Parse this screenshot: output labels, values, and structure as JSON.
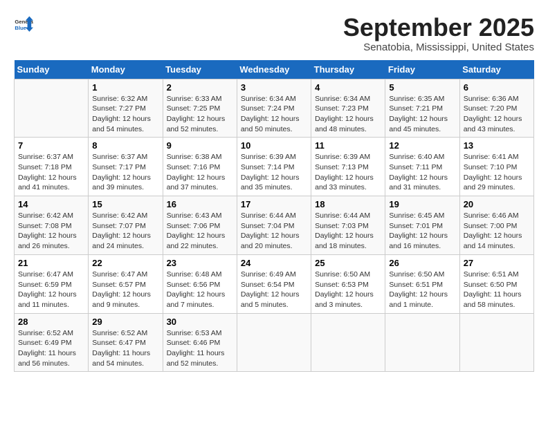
{
  "header": {
    "logo_general": "General",
    "logo_blue": "Blue",
    "month_title": "September 2025",
    "location": "Senatobia, Mississippi, United States"
  },
  "days_of_week": [
    "Sunday",
    "Monday",
    "Tuesday",
    "Wednesday",
    "Thursday",
    "Friday",
    "Saturday"
  ],
  "weeks": [
    [
      {
        "day": "",
        "info": ""
      },
      {
        "day": "1",
        "info": "Sunrise: 6:32 AM\nSunset: 7:27 PM\nDaylight: 12 hours\nand 54 minutes."
      },
      {
        "day": "2",
        "info": "Sunrise: 6:33 AM\nSunset: 7:25 PM\nDaylight: 12 hours\nand 52 minutes."
      },
      {
        "day": "3",
        "info": "Sunrise: 6:34 AM\nSunset: 7:24 PM\nDaylight: 12 hours\nand 50 minutes."
      },
      {
        "day": "4",
        "info": "Sunrise: 6:34 AM\nSunset: 7:23 PM\nDaylight: 12 hours\nand 48 minutes."
      },
      {
        "day": "5",
        "info": "Sunrise: 6:35 AM\nSunset: 7:21 PM\nDaylight: 12 hours\nand 45 minutes."
      },
      {
        "day": "6",
        "info": "Sunrise: 6:36 AM\nSunset: 7:20 PM\nDaylight: 12 hours\nand 43 minutes."
      }
    ],
    [
      {
        "day": "7",
        "info": "Sunrise: 6:37 AM\nSunset: 7:18 PM\nDaylight: 12 hours\nand 41 minutes."
      },
      {
        "day": "8",
        "info": "Sunrise: 6:37 AM\nSunset: 7:17 PM\nDaylight: 12 hours\nand 39 minutes."
      },
      {
        "day": "9",
        "info": "Sunrise: 6:38 AM\nSunset: 7:16 PM\nDaylight: 12 hours\nand 37 minutes."
      },
      {
        "day": "10",
        "info": "Sunrise: 6:39 AM\nSunset: 7:14 PM\nDaylight: 12 hours\nand 35 minutes."
      },
      {
        "day": "11",
        "info": "Sunrise: 6:39 AM\nSunset: 7:13 PM\nDaylight: 12 hours\nand 33 minutes."
      },
      {
        "day": "12",
        "info": "Sunrise: 6:40 AM\nSunset: 7:11 PM\nDaylight: 12 hours\nand 31 minutes."
      },
      {
        "day": "13",
        "info": "Sunrise: 6:41 AM\nSunset: 7:10 PM\nDaylight: 12 hours\nand 29 minutes."
      }
    ],
    [
      {
        "day": "14",
        "info": "Sunrise: 6:42 AM\nSunset: 7:08 PM\nDaylight: 12 hours\nand 26 minutes."
      },
      {
        "day": "15",
        "info": "Sunrise: 6:42 AM\nSunset: 7:07 PM\nDaylight: 12 hours\nand 24 minutes."
      },
      {
        "day": "16",
        "info": "Sunrise: 6:43 AM\nSunset: 7:06 PM\nDaylight: 12 hours\nand 22 minutes."
      },
      {
        "day": "17",
        "info": "Sunrise: 6:44 AM\nSunset: 7:04 PM\nDaylight: 12 hours\nand 20 minutes."
      },
      {
        "day": "18",
        "info": "Sunrise: 6:44 AM\nSunset: 7:03 PM\nDaylight: 12 hours\nand 18 minutes."
      },
      {
        "day": "19",
        "info": "Sunrise: 6:45 AM\nSunset: 7:01 PM\nDaylight: 12 hours\nand 16 minutes."
      },
      {
        "day": "20",
        "info": "Sunrise: 6:46 AM\nSunset: 7:00 PM\nDaylight: 12 hours\nand 14 minutes."
      }
    ],
    [
      {
        "day": "21",
        "info": "Sunrise: 6:47 AM\nSunset: 6:59 PM\nDaylight: 12 hours\nand 11 minutes."
      },
      {
        "day": "22",
        "info": "Sunrise: 6:47 AM\nSunset: 6:57 PM\nDaylight: 12 hours\nand 9 minutes."
      },
      {
        "day": "23",
        "info": "Sunrise: 6:48 AM\nSunset: 6:56 PM\nDaylight: 12 hours\nand 7 minutes."
      },
      {
        "day": "24",
        "info": "Sunrise: 6:49 AM\nSunset: 6:54 PM\nDaylight: 12 hours\nand 5 minutes."
      },
      {
        "day": "25",
        "info": "Sunrise: 6:50 AM\nSunset: 6:53 PM\nDaylight: 12 hours\nand 3 minutes."
      },
      {
        "day": "26",
        "info": "Sunrise: 6:50 AM\nSunset: 6:51 PM\nDaylight: 12 hours\nand 1 minute."
      },
      {
        "day": "27",
        "info": "Sunrise: 6:51 AM\nSunset: 6:50 PM\nDaylight: 11 hours\nand 58 minutes."
      }
    ],
    [
      {
        "day": "28",
        "info": "Sunrise: 6:52 AM\nSunset: 6:49 PM\nDaylight: 11 hours\nand 56 minutes."
      },
      {
        "day": "29",
        "info": "Sunrise: 6:52 AM\nSunset: 6:47 PM\nDaylight: 11 hours\nand 54 minutes."
      },
      {
        "day": "30",
        "info": "Sunrise: 6:53 AM\nSunset: 6:46 PM\nDaylight: 11 hours\nand 52 minutes."
      },
      {
        "day": "",
        "info": ""
      },
      {
        "day": "",
        "info": ""
      },
      {
        "day": "",
        "info": ""
      },
      {
        "day": "",
        "info": ""
      }
    ]
  ]
}
